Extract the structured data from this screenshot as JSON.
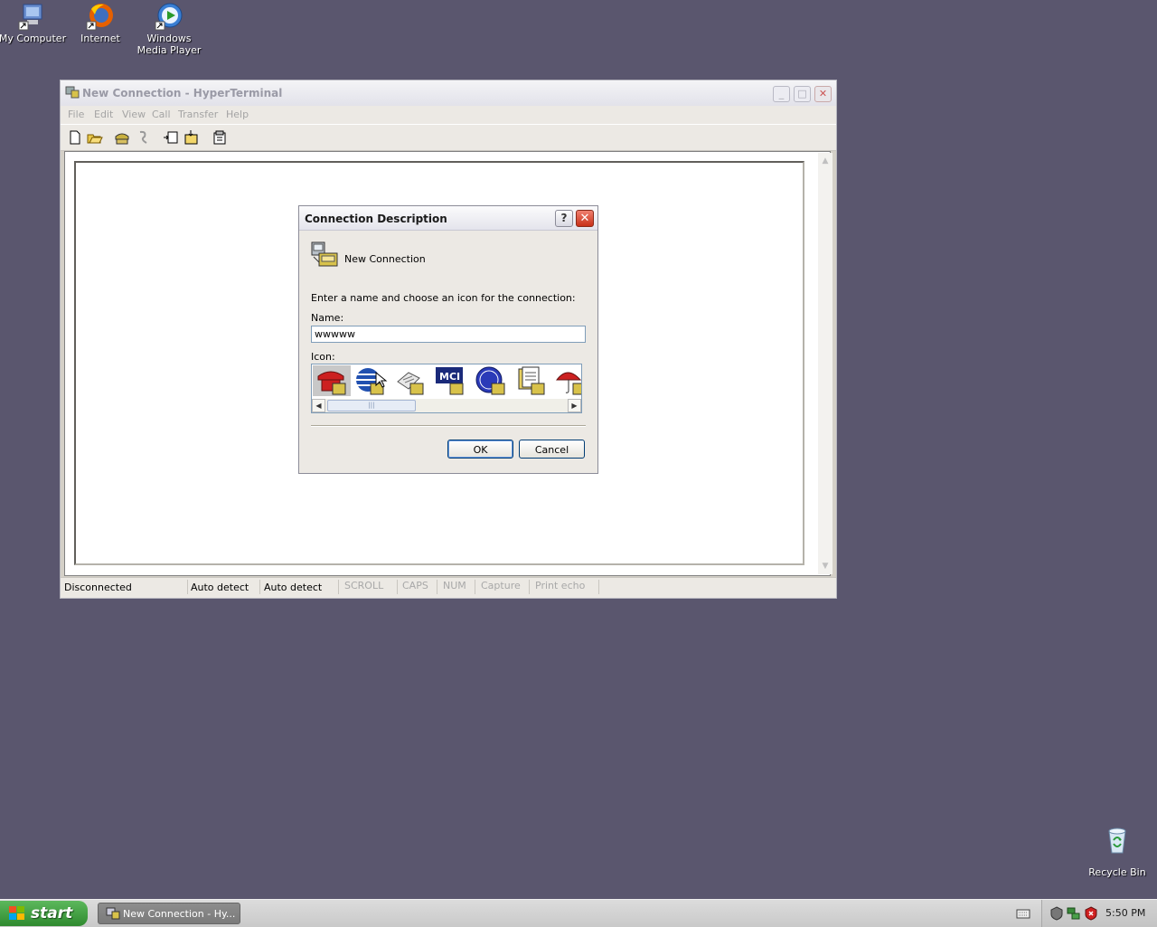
{
  "desktop": {
    "icons": [
      {
        "label": "My Computer"
      },
      {
        "label": "Internet"
      },
      {
        "label": "Windows\nMedia Player"
      }
    ],
    "recycle_bin": {
      "label": "Recycle Bin"
    }
  },
  "main_window": {
    "title": "New Connection - HyperTerminal",
    "menu": [
      "File",
      "Edit",
      "View",
      "Call",
      "Transfer",
      "Help"
    ],
    "toolbar": [
      "new-icon",
      "open-icon",
      "dial-icon",
      "disconnect-icon",
      "send-icon",
      "receive-icon",
      "properties-icon"
    ],
    "status": [
      "Disconnected",
      "Auto detect",
      "Auto detect",
      "SCROLL",
      "CAPS",
      "NUM",
      "Capture",
      "Print echo"
    ]
  },
  "dialog": {
    "title": "Connection Description",
    "help_label": "?",
    "close_label": "✕",
    "connection_name": "New Connection",
    "prompt": "Enter a name and choose an icon for the connection:",
    "name_label": "Name:",
    "name_value": "wwwww",
    "icon_label": "Icon:",
    "icons": [
      "phone-icon",
      "globe-icon",
      "fax-icon",
      "mci-icon",
      "ge-icon",
      "documents-icon",
      "umbrella-icon"
    ],
    "ok_label": "OK",
    "cancel_label": "Cancel"
  },
  "taskbar": {
    "start_label": "start",
    "task_label": "New Connection - Hy...",
    "clock": "5:50 PM"
  }
}
